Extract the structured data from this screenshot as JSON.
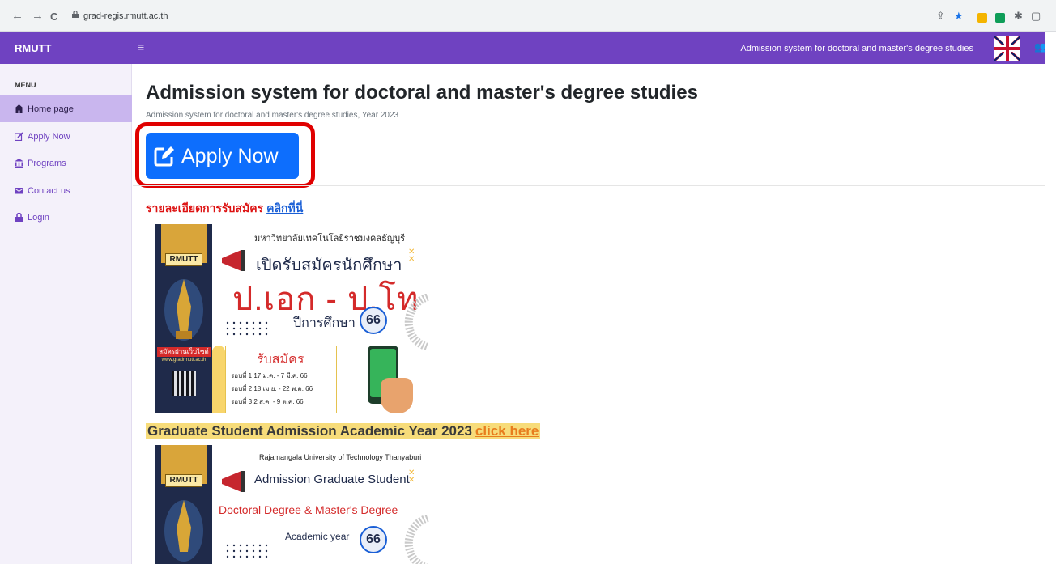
{
  "browser": {
    "url": "grad-regis.rmutt.ac.th",
    "back_glyph": "←",
    "forward_glyph": "→",
    "reload_glyph": "C",
    "extensions": [
      {
        "icon": "share-icon",
        "glyph": "⇪",
        "color": "#5f6368"
      },
      {
        "icon": "bookmark-star-icon",
        "glyph": "★",
        "color": "#1a73e8"
      },
      {
        "icon": "extension-yellow-icon",
        "color": "#f4b400"
      },
      {
        "icon": "extension-green-icon",
        "color": "#0f9d58"
      },
      {
        "icon": "puzzle-icon",
        "glyph": "✱",
        "color": "#5f6368"
      },
      {
        "icon": "sidepanel-icon",
        "glyph": "▢",
        "color": "#5f6368"
      }
    ]
  },
  "app": {
    "brand": "RMUTT",
    "header_title": "Admission system for doctoral and master's degree studies",
    "accent_color": "#6f42c1",
    "hamburger_glyph": "≡",
    "user_glyph": "👥"
  },
  "sidebar": {
    "heading": "MENU",
    "items": [
      {
        "label": "Home page",
        "icon": "home-icon",
        "active": true
      },
      {
        "label": "Apply Now",
        "icon": "edit-icon",
        "active": false
      },
      {
        "label": "Programs",
        "icon": "bank-icon",
        "active": false
      },
      {
        "label": "Contact us",
        "icon": "envelope-icon",
        "active": false
      },
      {
        "label": "Login",
        "icon": "lock-icon",
        "active": false
      }
    ]
  },
  "main": {
    "title": "Admission system for doctoral and master's degree studies",
    "subtitle": "Admission system for doctoral and master's degree studies, Year 2023",
    "apply_button": "Apply Now",
    "thai_details_text": "รายละเอียดการรับสมัคร",
    "thai_details_link": "คลิกที่นี่",
    "english_text": "Graduate Student Admission Academic Year 2023",
    "english_link": "click here"
  },
  "poster_th": {
    "university": "มหาวิทยาลัยเทคโนโลยีราชมงคลธัญบุรี",
    "headline": "เปิดรับสมัครนักศึกษา",
    "degrees": "ป.เอก - ป.โท",
    "year_label": "ปีการศึกษา",
    "year_num": "66",
    "logo_text": "RMUTT",
    "apply_online": "สมัครผ่านเว็บไซต์",
    "website": "www.gradrmutt.ac.th",
    "register": "รับสมัคร",
    "rounds": [
      "รอบที่ 1  17 ม.ค. -  7 มี.ค. 66",
      "รอบที่ 2 18 เม.ย. -  22 พ.ค. 66",
      "รอบที่ 3  2 ส.ค. -  9 ต.ค. 66"
    ]
  },
  "poster_en": {
    "university": "Rajamangala University of Technology Thanyaburi",
    "headline": "Admission Graduate Student",
    "degrees": "Doctoral Degree & Master's Degree",
    "year_label": "Academic year",
    "year_num": "66",
    "logo_text": "RMUTT"
  }
}
